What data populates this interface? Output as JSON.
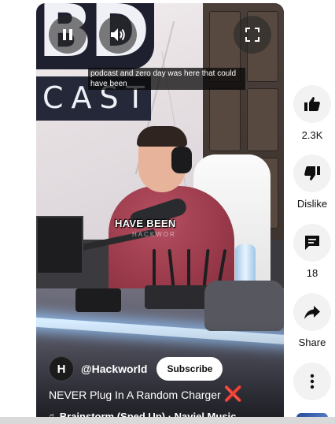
{
  "player": {
    "caption_text": "podcast and zero day was here that could have been",
    "burned_in_text": "HAVE BEEN",
    "watermark_text": "HACKWOR",
    "logo_top": "BD",
    "logo_bottom": "CAST",
    "controls": {
      "pause_icon": "pause-icon",
      "mute_icon": "volume-icon",
      "fullscreen_icon": "fullscreen-icon"
    }
  },
  "channel": {
    "avatar_letter": "H",
    "handle": "@Hackworld",
    "subscribe_label": "Subscribe"
  },
  "video": {
    "title": "NEVER Plug In A Random Charger",
    "title_emoji": "❌",
    "music_note": "♫",
    "music": "Brainstorm (Sped Up) · Naviel Music"
  },
  "actions": {
    "like_count": "2.3K",
    "dislike_label": "Dislike",
    "comment_count": "18",
    "share_label": "Share"
  },
  "colors": {
    "accent_red": "#e3262a",
    "rail_button_bg": "#f2f2f2",
    "text_primary": "#0f0f0f"
  }
}
